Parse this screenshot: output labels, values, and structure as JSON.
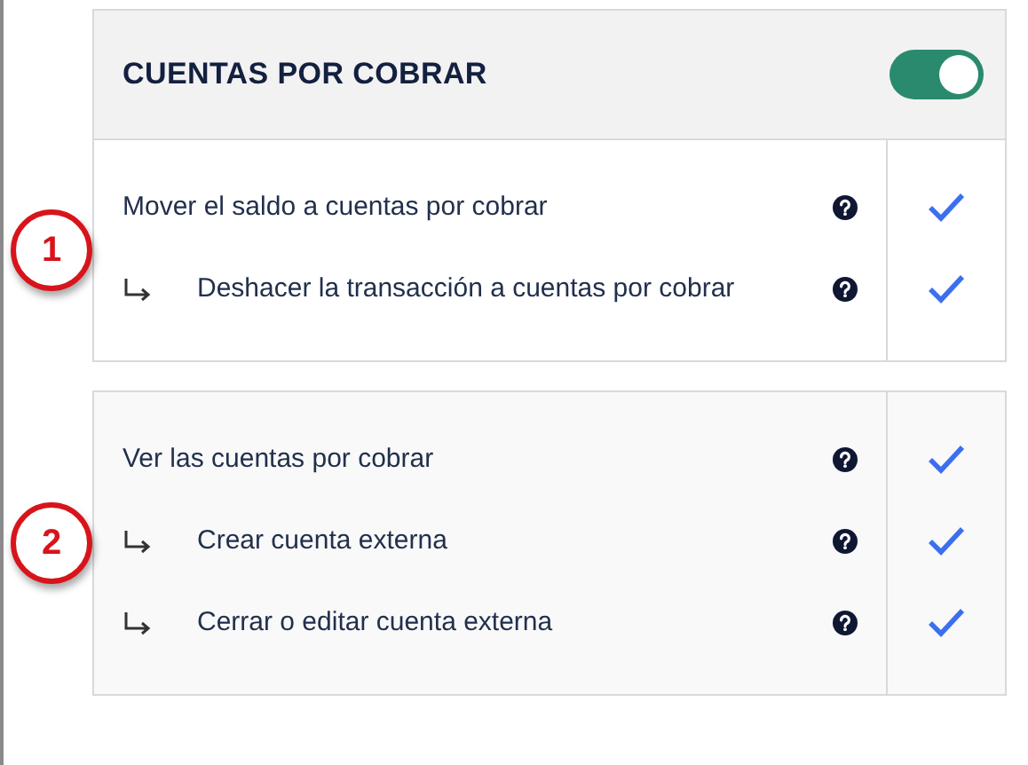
{
  "panel": {
    "title": "CUENTAS POR COBRAR",
    "toggle": {
      "on": true
    }
  },
  "sections": [
    {
      "callout": "1",
      "permissions": [
        {
          "label": "Mover el saldo a cuentas por cobrar",
          "checked": true,
          "children": [
            {
              "label": "Deshacer la transacción a cuentas por cobrar",
              "checked": true
            }
          ]
        }
      ]
    },
    {
      "callout": "2",
      "permissions": [
        {
          "label": "Ver las cuentas por cobrar",
          "checked": true,
          "children": [
            {
              "label": "Crear cuenta externa",
              "checked": true
            },
            {
              "label": "Cerrar o editar cuenta externa",
              "checked": true
            }
          ]
        }
      ]
    }
  ]
}
